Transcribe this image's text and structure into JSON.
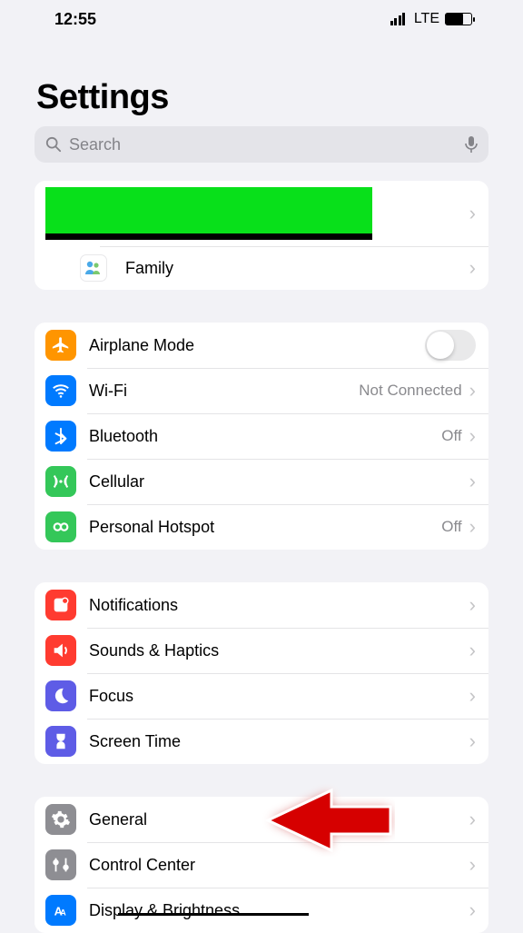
{
  "status": {
    "time": "12:55",
    "network": "LTE"
  },
  "page": {
    "title": "Settings"
  },
  "search": {
    "placeholder": "Search"
  },
  "profile": {
    "family": "Family"
  },
  "groups": {
    "connectivity": {
      "airplane": "Airplane Mode",
      "wifi": "Wi-Fi",
      "wifi_detail": "Not Connected",
      "bluetooth": "Bluetooth",
      "bluetooth_detail": "Off",
      "cellular": "Cellular",
      "hotspot": "Personal Hotspot",
      "hotspot_detail": "Off"
    },
    "notifications_group": {
      "notifications": "Notifications",
      "sounds": "Sounds & Haptics",
      "focus": "Focus",
      "screentime": "Screen Time"
    },
    "general_group": {
      "general": "General",
      "control_center": "Control Center",
      "display": "Display & Brightness"
    }
  }
}
